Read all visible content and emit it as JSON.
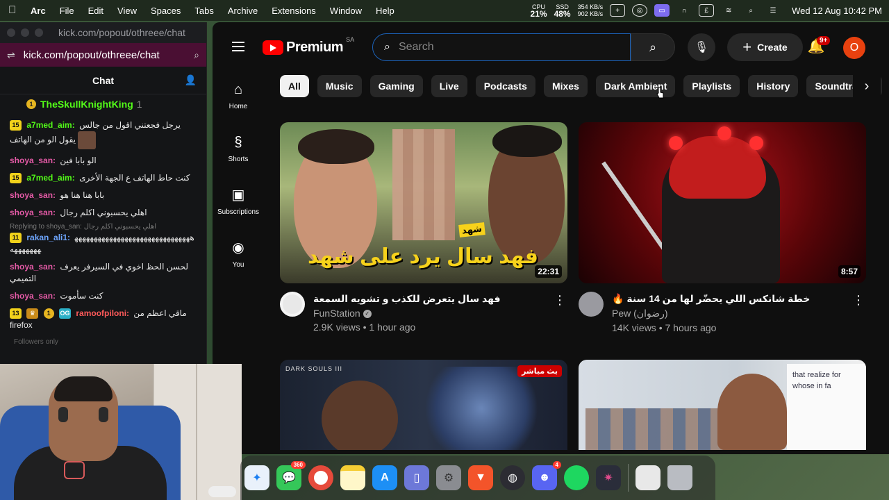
{
  "menubar": {
    "app_name": "Arc",
    "menus": [
      "File",
      "Edit",
      "View",
      "Spaces",
      "Tabs",
      "Archive",
      "Extensions",
      "Window",
      "Help"
    ],
    "cpu_label": "CPU",
    "cpu_value": "21%",
    "ssd_label": "SSD",
    "ssd_value": "48%",
    "net_up": "354 KB/s",
    "net_down": "902 KB/s",
    "clock": "Wed 12 Aug  10:42 PM"
  },
  "kick": {
    "titlebar_url": "kick.com/popout/othreee/chat",
    "address": "kick.com/popout/othreee/chat",
    "chat_title": "Chat",
    "pinned_user": "TheSkullKnightKing",
    "pinned_count": "1",
    "messages": [
      {
        "badge": "15",
        "user": "a7med_aim:",
        "text": "يرجل فجعتني اقول من جالس يقول الو من الهاتف"
      },
      {
        "badge": "",
        "user": "shoya_san:",
        "text": "الو بابا فين"
      },
      {
        "badge": "15",
        "user": "a7med_aim:",
        "text": "كنت حاط الهاتف ع الجهة الأخرى"
      },
      {
        "badge": "",
        "user": "shoya_san:",
        "text": "بابا هنا هنا هو"
      },
      {
        "badge": "",
        "user": "shoya_san:",
        "text": "اهلي يحسبوني اكلم رجال"
      },
      {
        "badge": "11",
        "user": "rakan_ali1:",
        "text": "ههههههههههههههههههههههههههههههههههههههه"
      },
      {
        "badge": "",
        "user": "shoya_san:",
        "text": "لحسن الحظ اخوي في السيرفر يعرف التميمي"
      },
      {
        "badge": "",
        "user": "shoya_san:",
        "text": "كنت سأموت"
      },
      {
        "badge": "13",
        "user": "ramoofpiloni:",
        "text": "ماقي اعظم من firefox"
      }
    ],
    "reply_text": "Replying to shoya_san: اهلي يحسبوني اكلم رجال",
    "footer": "Followers only"
  },
  "youtube": {
    "brand": "Premium",
    "region": "SA",
    "search_placeholder": "Search",
    "create_label": "Create",
    "notif_count": "9+",
    "avatar_letter": "O",
    "nav": [
      {
        "label": "Home",
        "icon": "home-icon"
      },
      {
        "label": "Shorts",
        "icon": "shorts-icon"
      },
      {
        "label": "Subscriptions",
        "icon": "subscriptions-icon"
      },
      {
        "label": "You",
        "icon": "you-icon"
      }
    ],
    "chips": [
      "All",
      "Music",
      "Gaming",
      "Live",
      "Podcasts",
      "Mixes",
      "Dark Ambient",
      "Playlists",
      "History",
      "Soundtracks"
    ],
    "videos": [
      {
        "title": "فهد سال يتعرض للكذب و تشويه السمعة",
        "channel": "FunStation",
        "stats": "2.9K views • 1 hour ago",
        "duration": "22:31",
        "thumb_caption": "فهد سال يرد على شهد",
        "thumb_tag": "شهد"
      },
      {
        "title": "🔥 خطة شانكس اللي يحضّر لها من 14 سنة",
        "channel": "Pew (رضوان)",
        "stats": "14K views • 7 hours ago",
        "duration": "8:57"
      },
      {
        "thumb_brand": "DARK SOULS III",
        "live_badge": "بث مباشر"
      },
      {
        "board_text": "that realize for whose in fa"
      }
    ]
  },
  "dock": {
    "messages_badge": "360",
    "discord_badge": "4"
  }
}
